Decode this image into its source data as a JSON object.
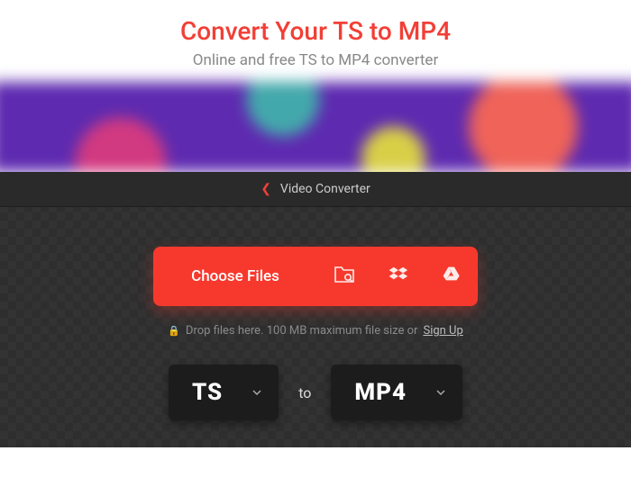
{
  "header": {
    "title": "Convert Your TS to MP4",
    "subtitle": "Online and free TS to MP4 converter"
  },
  "breadcrumb": {
    "label": "Video Converter"
  },
  "upload": {
    "choose_label": "Choose Files"
  },
  "hint": {
    "text": "Drop files here. 100 MB maximum file size or ",
    "signup": "Sign Up"
  },
  "formats": {
    "from": "TS",
    "to_label": "to",
    "to": "MP4"
  }
}
